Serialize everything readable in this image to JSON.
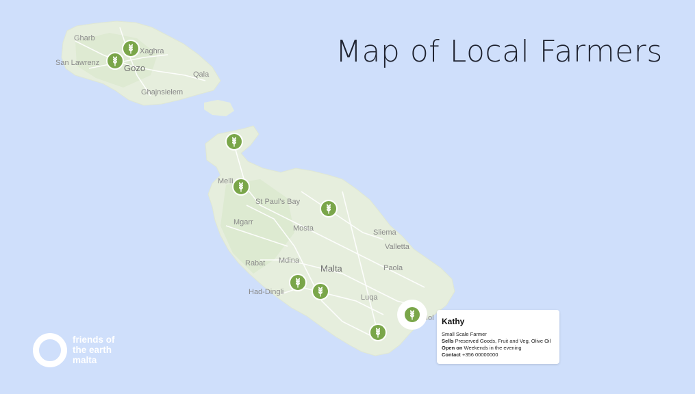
{
  "title": "Map of Local Farmers",
  "places": [
    {
      "key": "gharb",
      "label": "Gharb"
    },
    {
      "key": "xaghra",
      "label": "Xaghra"
    },
    {
      "key": "san_lawrenz",
      "label": "San Lawrenz"
    },
    {
      "key": "gozo",
      "label": "Gozo"
    },
    {
      "key": "qala",
      "label": "Qala"
    },
    {
      "key": "ghajnsielem",
      "label": "Ghajnsielem"
    },
    {
      "key": "mellieha",
      "label": "Melli"
    },
    {
      "key": "st_pauls_bay",
      "label": "St Paul's Bay"
    },
    {
      "key": "mgarr",
      "label": "Mgarr"
    },
    {
      "key": "mosta",
      "label": "Mosta"
    },
    {
      "key": "sliema",
      "label": "Sliema"
    },
    {
      "key": "valletta",
      "label": "Valletta"
    },
    {
      "key": "rabat",
      "label": "Rabat"
    },
    {
      "key": "mdina",
      "label": "Mdina"
    },
    {
      "key": "malta",
      "label": "Malta"
    },
    {
      "key": "paola",
      "label": "Paola"
    },
    {
      "key": "had_dingli",
      "label": "Had-Dingli"
    },
    {
      "key": "luqa",
      "label": "Luqa"
    },
    {
      "key": "zejtun_partial",
      "label": "Iol"
    }
  ],
  "marker_icon": "wheat-icon",
  "popup": {
    "name": "Kathy",
    "type": "Small Scale Farmer",
    "sells_label": "Sells",
    "sells": "Preserved Goods, Fruit and Veg, Olive Oil",
    "open_label": "Open on",
    "open": "Weekends in the evening",
    "contact_label": "Contact",
    "contact": "+356 00000000"
  },
  "logo": {
    "line1": "friends of",
    "line2": "the earth",
    "line3": "malta"
  },
  "colors": {
    "sea": "#cfdffb",
    "land": "#e9efe1",
    "marker": "#7aa64a",
    "title": "#1f2330"
  }
}
